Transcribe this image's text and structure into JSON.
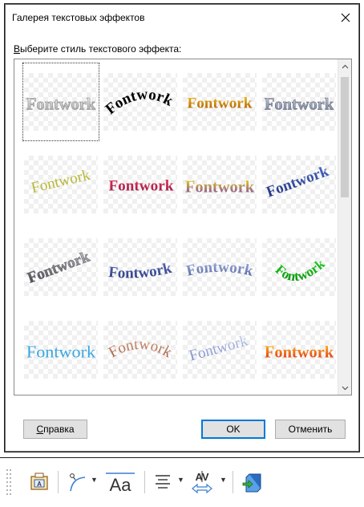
{
  "dialog": {
    "title": "Галерея текстовых эффектов",
    "prompt_underlined": "В",
    "prompt_rest": "ыберите стиль текстового эффекта:",
    "close_icon": "close-icon"
  },
  "gallery": {
    "item_text": "Fontwork",
    "selected_index": 0,
    "items": [
      {
        "style": "outline-gray",
        "colors": [
          "#ffffff",
          "#9a9a9a"
        ]
      },
      {
        "style": "arch-black",
        "colors": [
          "#000000",
          "#000000"
        ]
      },
      {
        "style": "gold-gradient",
        "colors": [
          "#f6c21a",
          "#a34b00"
        ]
      },
      {
        "style": "silver-3d",
        "colors": [
          "#d0d8e8",
          "#6b7a96"
        ]
      },
      {
        "style": "slant-olive",
        "colors": [
          "#b8b83a",
          "#b8b83a"
        ]
      },
      {
        "style": "perspective-red",
        "colors": [
          "#e8345a",
          "#8e1a46"
        ]
      },
      {
        "style": "yellow-purple",
        "colors": [
          "#f4e600",
          "#7a3ab8"
        ]
      },
      {
        "style": "blue-rise",
        "colors": [
          "#4a6cc8",
          "#20307a"
        ]
      },
      {
        "style": "gray-tilt",
        "colors": [
          "#c8c8c8",
          "#3a3a3a"
        ]
      },
      {
        "style": "wave-blue",
        "colors": [
          "#5a6cb8",
          "#2a3a80"
        ]
      },
      {
        "style": "bubble-blue",
        "colors": [
          "#a8b8e8",
          "#4a5a98"
        ]
      },
      {
        "style": "green-curve",
        "colors": [
          "#22dd22",
          "#0b8a0b"
        ]
      },
      {
        "style": "plain-blue",
        "colors": [
          "#3aa6e0",
          "#3aa6e0"
        ]
      },
      {
        "style": "arc-brown",
        "colors": [
          "#d8a080",
          "#9a5030"
        ]
      },
      {
        "style": "light-slant",
        "colors": [
          "#c8d4f0",
          "#6c7ec0"
        ]
      },
      {
        "style": "orange-red",
        "colors": [
          "#ffcc22",
          "#e02010"
        ]
      }
    ]
  },
  "buttons": {
    "help_underlined": "С",
    "help_rest": "правка",
    "ok": "OK",
    "cancel": "Отменить"
  },
  "toolbar": {
    "items": [
      "text-frame-icon",
      "curve-icon",
      "text-size-icon",
      "align-icon",
      "spacing-icon",
      "extrusion-icon"
    ]
  }
}
